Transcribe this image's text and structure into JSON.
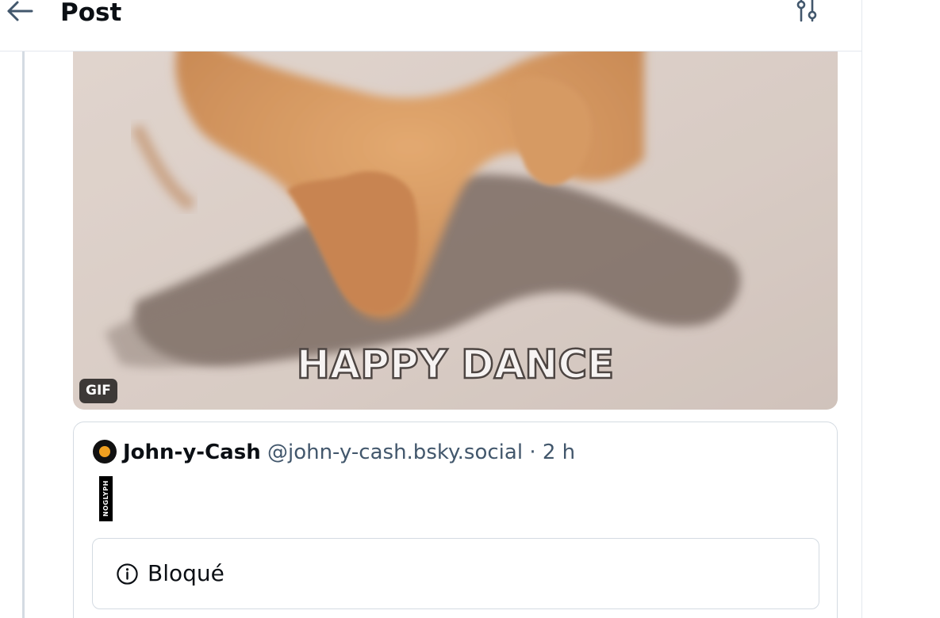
{
  "header": {
    "title": "Post",
    "back_icon": "arrow-left-icon",
    "settings_icon": "sliders-icon"
  },
  "media": {
    "gif_caption": "HAPPY DANCE",
    "badge": "GIF"
  },
  "quote": {
    "author_name": "John-y-Cash",
    "author_handle": "@john-y-cash.bsky.social",
    "separator": " · ",
    "time": "2 h",
    "glyph_text": "NOGLYPH",
    "blocked_label": "Bloqué",
    "blocked_icon": "info-circle-icon"
  },
  "colors": {
    "text": "#0b0f14",
    "muted": "#42576c",
    "border": "#d4dbe2",
    "icon": "#42576c"
  }
}
